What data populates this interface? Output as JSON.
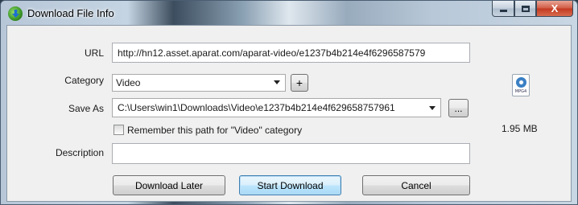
{
  "window": {
    "title": "Download File Info",
    "caption_minimize": "",
    "caption_maximize": "",
    "caption_close": "X"
  },
  "form": {
    "url_label": "URL",
    "url_value": "http://hn12.asset.aparat.com/aparat-video/e1237b4b214e4f6296587579",
    "category_label": "Category",
    "category_value": "Video",
    "add_category_label": "+",
    "save_as_label": "Save As",
    "save_as_value": "C:\\Users\\win1\\Downloads\\Video\\e1237b4b214e4f629658757961",
    "browse_label": "...",
    "remember_path_label": "Remember this path for \"Video\" category",
    "remember_path_checked": false,
    "description_label": "Description",
    "description_value": ""
  },
  "file_info": {
    "icon_name": "mp4-file-icon",
    "icon_ext": "MPG4",
    "size": "1.95 MB"
  },
  "buttons": {
    "download_later": "Download Later",
    "start_download": "Start Download",
    "cancel": "Cancel"
  }
}
